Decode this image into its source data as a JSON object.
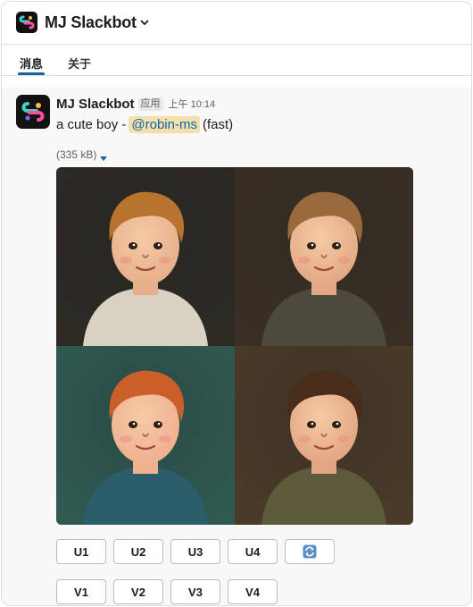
{
  "header": {
    "title": "MJ Slackbot"
  },
  "tabs": [
    {
      "label": "消息",
      "active": true
    },
    {
      "label": "关于",
      "active": false
    }
  ],
  "message": {
    "sender": "MJ Slackbot",
    "badge": "应用",
    "time": "上午 10:14",
    "text_prefix": "a cute boy -",
    "mention": "@robin-ms",
    "text_suffix": "(fast)",
    "file_size": "(335 kB)"
  },
  "images": [
    {
      "name": "boy-portrait-1",
      "bg": "#2d2a24",
      "hair": "#b8742e"
    },
    {
      "name": "boy-portrait-2",
      "bg": "#3a2f25",
      "hair": "#9a6a3c"
    },
    {
      "name": "boy-portrait-3",
      "bg": "#2f5a52",
      "hair": "#c9602a"
    },
    {
      "name": "boy-portrait-4",
      "bg": "#4a3a28",
      "hair": "#4a2c1a"
    }
  ],
  "buttons": {
    "upscale": [
      "U1",
      "U2",
      "U3",
      "U4"
    ],
    "variation": [
      "V1",
      "V2",
      "V3",
      "V4"
    ],
    "refresh_icon": "refresh-icon"
  },
  "colors": {
    "accent": "#1264a3",
    "mention_bg": "#f2e1ae"
  }
}
